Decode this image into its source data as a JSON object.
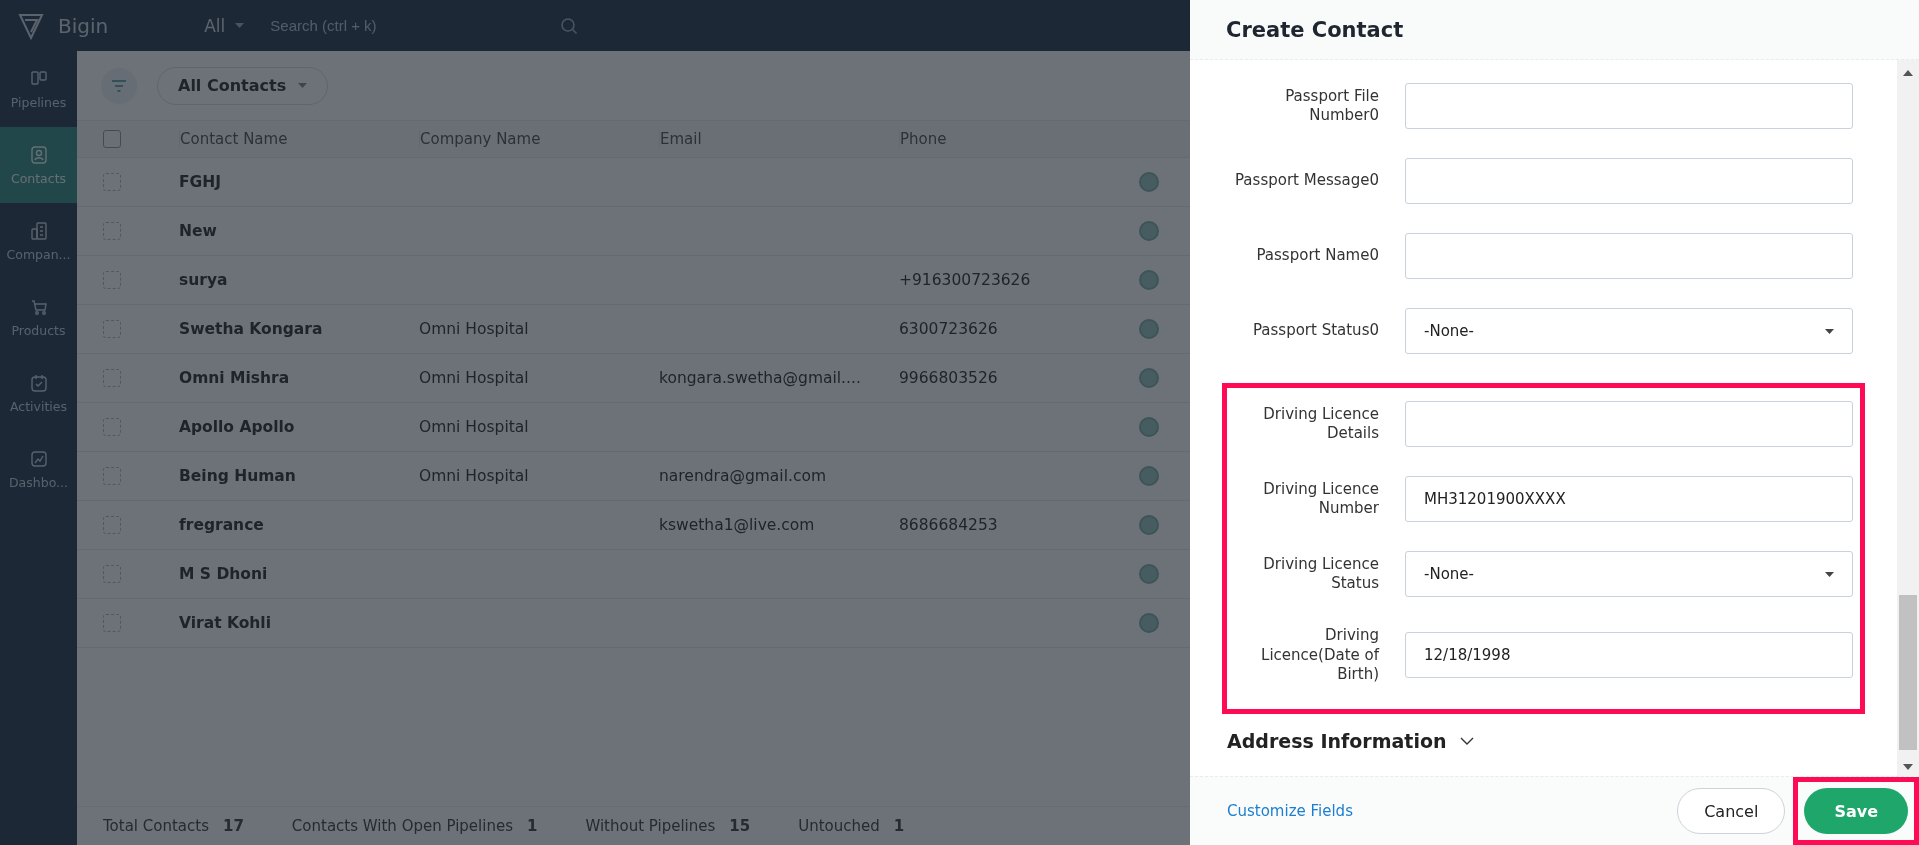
{
  "topbar": {
    "app_name": "Bigin",
    "scope": "All",
    "search_placeholder": "Search (ctrl + k)"
  },
  "sidebar": {
    "items": [
      {
        "label": "Pipelines",
        "selected": false
      },
      {
        "label": "Contacts",
        "selected": true
      },
      {
        "label": "Compan...",
        "selected": false
      },
      {
        "label": "Products",
        "selected": false
      },
      {
        "label": "Activities",
        "selected": false
      },
      {
        "label": "Dashbo...",
        "selected": false
      }
    ]
  },
  "toolbar": {
    "view": "All Contacts"
  },
  "table": {
    "columns": [
      "Contact Name",
      "Company Name",
      "Email",
      "Phone"
    ],
    "select_all_checked": false,
    "rows": [
      {
        "contact_name": "FGHJ",
        "checked": false
      },
      {
        "contact_name": "New",
        "checked": false
      },
      {
        "contact_name": "surya",
        "phone": "+916300723626",
        "checked": false
      },
      {
        "contact_name": "Swetha Kongara",
        "company_name": "Omni Hospital",
        "phone": "6300723626",
        "checked": false
      },
      {
        "contact_name": "Omni Mishra",
        "company_name": "Omni Hospital",
        "email": "kongara.swetha@gmail....",
        "phone": "9966803526",
        "checked": false
      },
      {
        "contact_name": "Apollo Apollo",
        "company_name": "Omni Hospital",
        "checked": false
      },
      {
        "contact_name": "Being Human",
        "company_name": "Omni Hospital",
        "email": "narendra@gmail.com",
        "checked": false
      },
      {
        "contact_name": "fregrance",
        "email": "kswetha1@live.com",
        "phone": "8686684253",
        "checked": false
      },
      {
        "contact_name": "M S Dhoni",
        "checked": false
      },
      {
        "contact_name": "Virat Kohli",
        "checked": false
      }
    ]
  },
  "status_bar": [
    {
      "label": "Total Contacts",
      "value": "17"
    },
    {
      "label": "Contacts With Open Pipelines",
      "value": "1"
    },
    {
      "label": "Without Pipelines",
      "value": "15"
    },
    {
      "label": "Untouched",
      "value": "1"
    }
  ],
  "panel": {
    "title": "Create Contact",
    "field_groups": [
      {
        "highlighted": false,
        "fields": [
          {
            "kind": "text",
            "label": "Passport File Number0"
          },
          {
            "kind": "text",
            "label": "Passport Message0"
          },
          {
            "kind": "text",
            "label": "Passport Name0"
          },
          {
            "kind": "select",
            "label": "Passport Status0",
            "value": "-None-"
          }
        ]
      },
      {
        "highlighted": true,
        "fields": [
          {
            "kind": "text",
            "label": "Driving Licence Details"
          },
          {
            "kind": "text",
            "label": "Driving Licence Number",
            "value": "MH31201900XXXX"
          },
          {
            "kind": "select",
            "label": "Driving Licence Status",
            "value": "-None-"
          },
          {
            "kind": "text",
            "label": "Driving Licence(Date of Birth)",
            "value": "12/18/1998"
          }
        ]
      }
    ],
    "section": {
      "title": "Address Information",
      "expanded": false
    },
    "footer": {
      "link": "Customize Fields",
      "buttons": [
        {
          "label": "Cancel",
          "kind": "secondary",
          "highlighted": false
        },
        {
          "label": "Save",
          "kind": "primary",
          "highlighted": true
        }
      ]
    }
  }
}
